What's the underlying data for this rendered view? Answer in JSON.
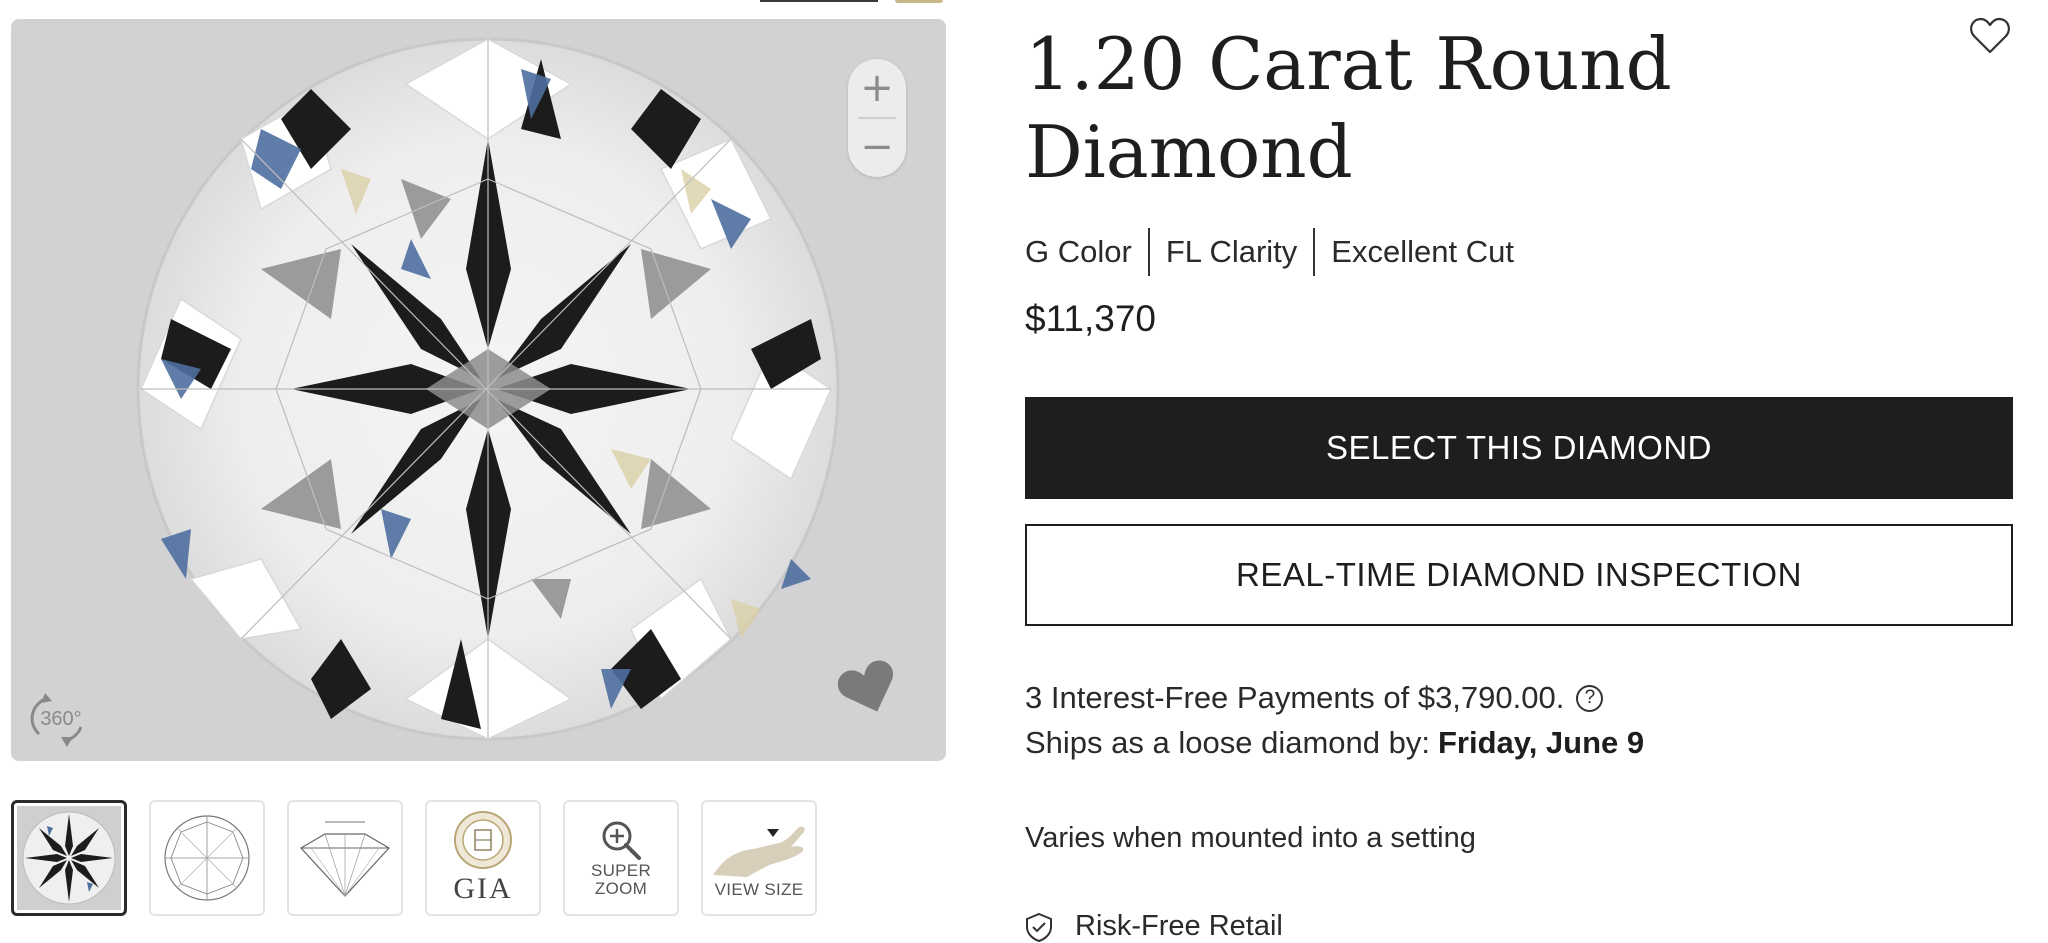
{
  "product": {
    "title": "1.20 Carat Round Diamond",
    "specs": [
      "G Color",
      "FL Clarity",
      "Excellent Cut"
    ],
    "price": "$11,370"
  },
  "actions": {
    "select_label": "SELECT THIS DIAMOND",
    "inspect_label": "REAL-TIME DIAMOND INSPECTION"
  },
  "payments": {
    "text": "3 Interest-Free Payments of $3,790.00.",
    "help": "?"
  },
  "shipping": {
    "label": "Ships as a loose diamond by:",
    "date": "Friday, June 9"
  },
  "note": "Varies when mounted into a setting",
  "risk_free": "Risk-Free Retail",
  "viewer": {
    "zoom_in": "+",
    "zoom_out": "−",
    "rotate_label": "360°"
  },
  "thumbnails": {
    "gia": "GIA",
    "super_zoom": [
      "SUPER",
      "ZOOM"
    ],
    "view_size": "VIEW SIZE"
  },
  "icons": [
    "heart-outline-icon",
    "zoom-in-icon",
    "zoom-out-icon",
    "rotate-360-icon",
    "heart-filled-icon",
    "magnifier-plus-icon",
    "hand-icon",
    "shield-check-icon",
    "help-circle-icon"
  ],
  "colors": {
    "primary_button": "#1e1e1e",
    "viewer_bg": "#d2d2d4",
    "text": "#1e1e1e"
  }
}
